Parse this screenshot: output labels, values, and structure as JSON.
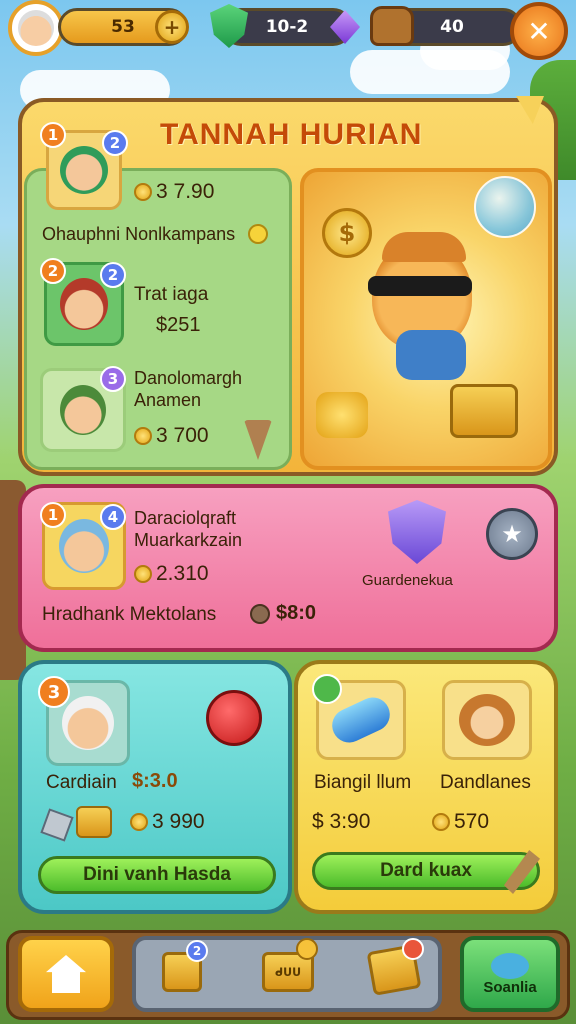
{
  "header": {
    "coins": "53",
    "gems": "10-2",
    "currency3": "40",
    "close_symbol": "✕"
  },
  "main_panel": {
    "title": "TANNAH HURIAN",
    "items": [
      {
        "badge_left": "1",
        "badge_right": "2",
        "price": "3 7.90",
        "name": "Ohauphni Nonlkampans"
      },
      {
        "badge_left": "2",
        "badge_right": "2",
        "name": "Trat iaga",
        "price": "$251"
      },
      {
        "badge_right": "3",
        "name_line1": "Danolomargh",
        "name_line2": "Anamen",
        "price": "3 700"
      }
    ]
  },
  "pink_panel": {
    "badge_left": "1",
    "badge_right": "4",
    "name_line1": "Daraciolqraft",
    "name_line2": "Muarkarkzain",
    "price": "2.310",
    "shield_label": "Guardenekua",
    "footer_text": "Hradhank Mektolans",
    "footer_price": "$8:0"
  },
  "teal_panel": {
    "badge": "3",
    "label": "Cardiain",
    "label_price": "$:3.0",
    "price": "3 990",
    "button": "Dini vanh Hasda"
  },
  "yellow_panel": {
    "item1_name": "Biangil llum",
    "item1_price": "$ 3:90",
    "item2_name": "Dandlanes",
    "item2_price": "570",
    "button": "Dard kuax"
  },
  "bottom_nav": {
    "badge1": "2",
    "label3": "ᑯᑌᑌ",
    "label_right": "Soanlia"
  },
  "colors": {
    "panel_yellow": "#f6c24a",
    "panel_green": "#9fd47a",
    "panel_pink": "#f27aa3",
    "panel_teal": "#6ed9d6",
    "accent_orange": "#f08a1e"
  }
}
